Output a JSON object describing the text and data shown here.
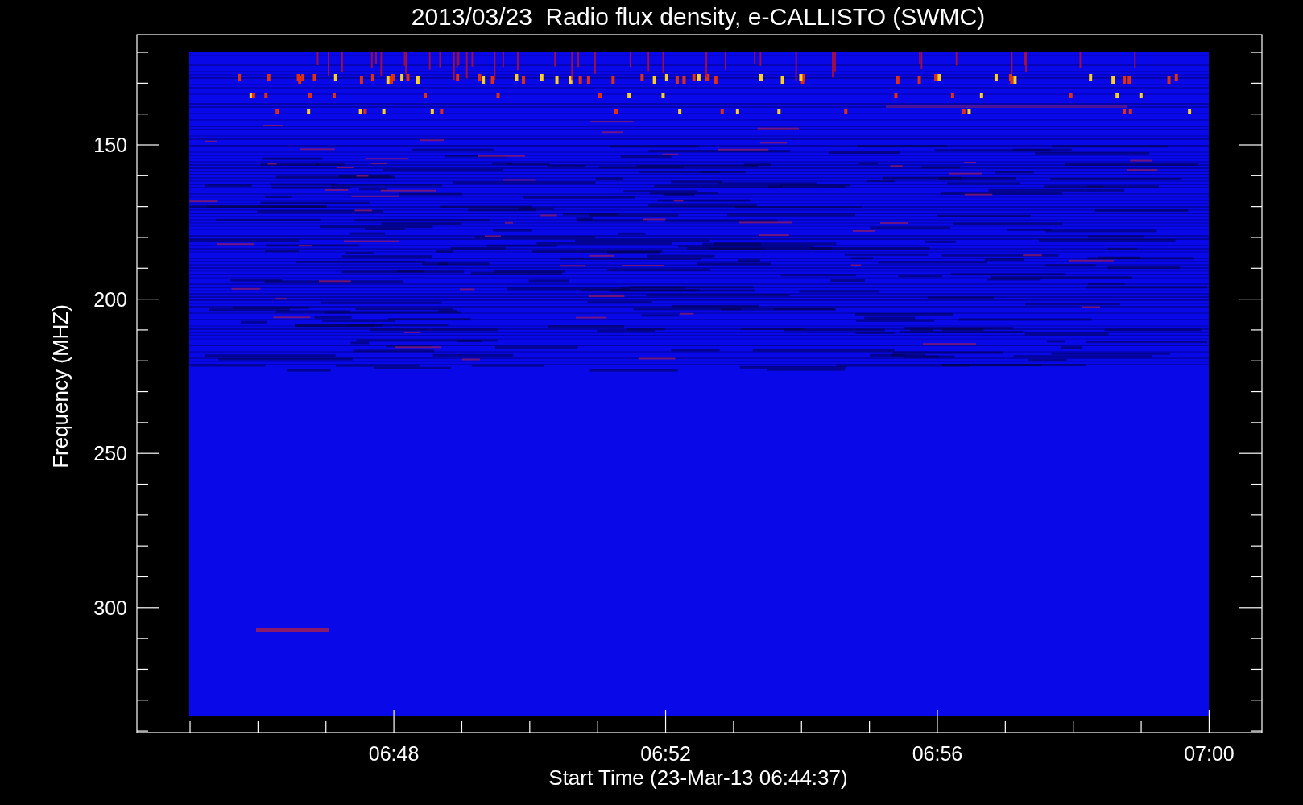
{
  "plot": {
    "title": "2013/03/23  Radio flux density, e-CALLISTO (SWMC)",
    "ylabel": "Frequency (MHZ)",
    "xlabel": "Start Time (23-Mar-13 06:44:37)",
    "yticks": [
      "150",
      "200",
      "250",
      "300"
    ],
    "xticks": [
      "06:48",
      "06:52",
      "06:56",
      "07:00"
    ]
  }
}
